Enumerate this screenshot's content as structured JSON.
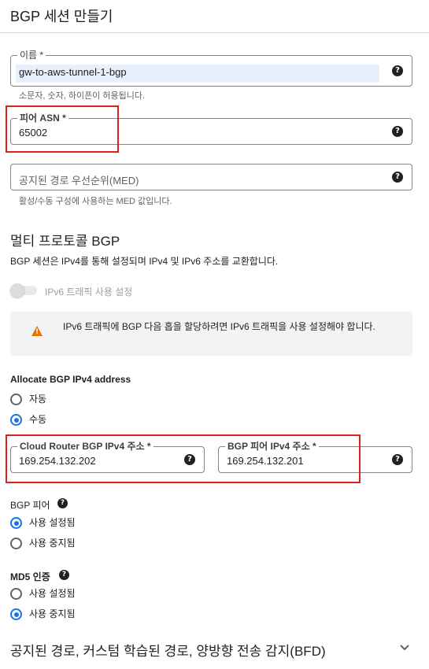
{
  "header": {
    "title": "BGP 세션 만들기"
  },
  "name_field": {
    "label": "이름 *",
    "value": "gw-to-aws-tunnel-1-bgp",
    "hint": "소문자, 숫자, 하이픈이 허용됩니다."
  },
  "peer_asn_field": {
    "label": "피어 ASN *",
    "value": "65002"
  },
  "med_field": {
    "placeholder": "공지된 경로 우선순위(MED)",
    "hint": "활성/수동 구성에 사용하는 MED 값입니다."
  },
  "multiprotocol": {
    "title": "멀티 프로토콜 BGP",
    "description": "BGP 세션은 IPv4를 통해 설정되며 IPv4 및 IPv6 주소를 교환합니다.",
    "toggle_label": "IPv6 트래픽 사용 설정",
    "warning": "IPv6 트래픽에 BGP 다음 홉을 할당하려면 IPv6 트래픽을 사용 설정해야 합니다."
  },
  "allocate": {
    "title": "Allocate BGP IPv4 address",
    "options": [
      "자동",
      "수동"
    ],
    "selected": "수동"
  },
  "cloud_router_ip": {
    "label": "Cloud Router BGP IPv4 주소 *",
    "value": "169.254.132.202"
  },
  "bgp_peer_ip": {
    "label": "BGP 피어 IPv4 주소 *",
    "value": "169.254.132.201"
  },
  "bgp_peer": {
    "title": "BGP 피어",
    "options": [
      "사용 설정됨",
      "사용 중지됨"
    ],
    "selected": "사용 설정됨"
  },
  "md5": {
    "title": "MD5 인증",
    "options": [
      "사용 설정됨",
      "사용 중지됨"
    ],
    "selected": "사용 중지됨"
  },
  "expander": {
    "title": "공지된 경로, 커스텀 학습된 경로, 양방향 전송 감지(BFD)"
  },
  "icons": {
    "help": "?",
    "warning": "!"
  },
  "colors": {
    "accent": "#1a73e8",
    "warning": "#e37400",
    "highlight": "#e0201c"
  }
}
